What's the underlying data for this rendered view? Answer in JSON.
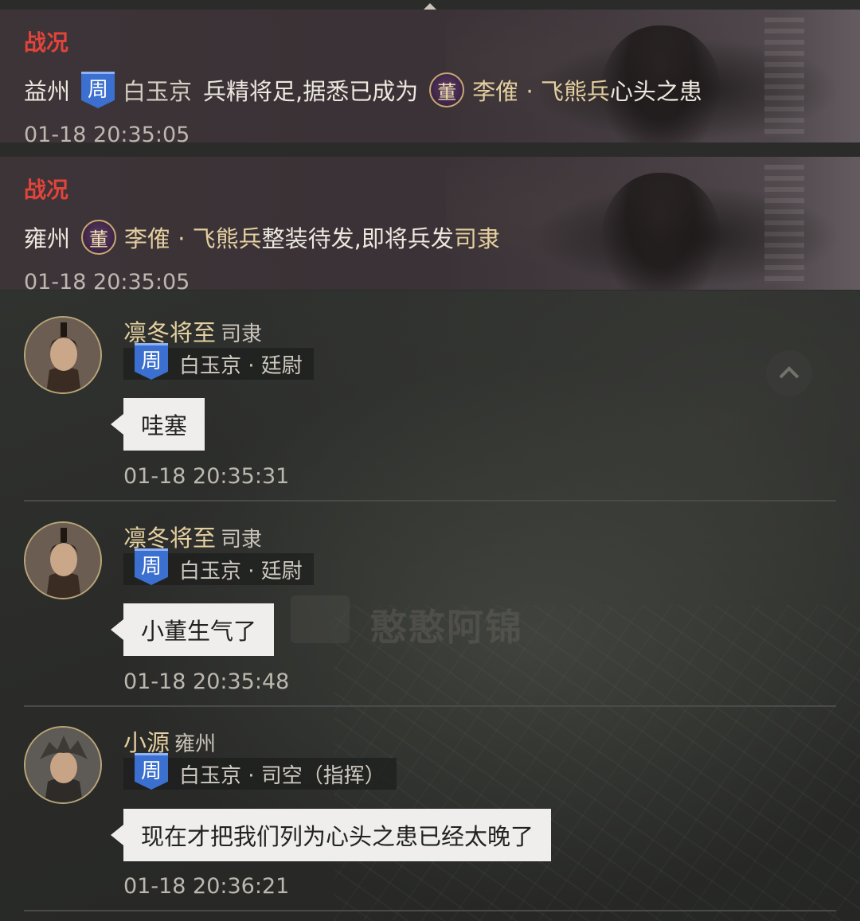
{
  "war_reports": [
    {
      "title": "战况",
      "region": "益州",
      "banner_char": "周",
      "city": "白玉京",
      "text_a": "兵精将足,据悉已成为",
      "seal_char": "董",
      "enemy": "李傕 · 飞熊兵",
      "text_b": "心头之患",
      "time": "01-18 20:35:05"
    },
    {
      "title": "战况",
      "region": "雍州",
      "seal_char": "董",
      "enemy": "李傕 · 飞熊兵",
      "text_a": "整装待发,即将兵发",
      "target": "司隶",
      "time": "01-18 20:35:05"
    }
  ],
  "messages": [
    {
      "name": "凛冬将至",
      "location": "司隶",
      "banner_char": "周",
      "affiliation": "白玉京 · 廷尉",
      "text": "哇塞",
      "time": "01-18 20:35:31"
    },
    {
      "name": "凛冬将至",
      "location": "司隶",
      "banner_char": "周",
      "affiliation": "白玉京 · 廷尉",
      "text": "小董生气了",
      "time": "01-18 20:35:48"
    },
    {
      "name": "小源",
      "location": "雍州",
      "banner_char": "周",
      "affiliation": "白玉京 · 司空（指挥）",
      "text": "现在才把我们列为心头之患已经太晚了",
      "time": "01-18 20:36:21"
    }
  ],
  "watermark": "憨憨阿锦",
  "icons": {
    "collapse": "chevron-up-icon",
    "scroll_up": "chevron-up-icon"
  },
  "colors": {
    "war_title": "#e2443b",
    "highlight": "#e4cfa0",
    "faction_blue": "#3b6fd0",
    "faction_purple": "#3c2446"
  }
}
